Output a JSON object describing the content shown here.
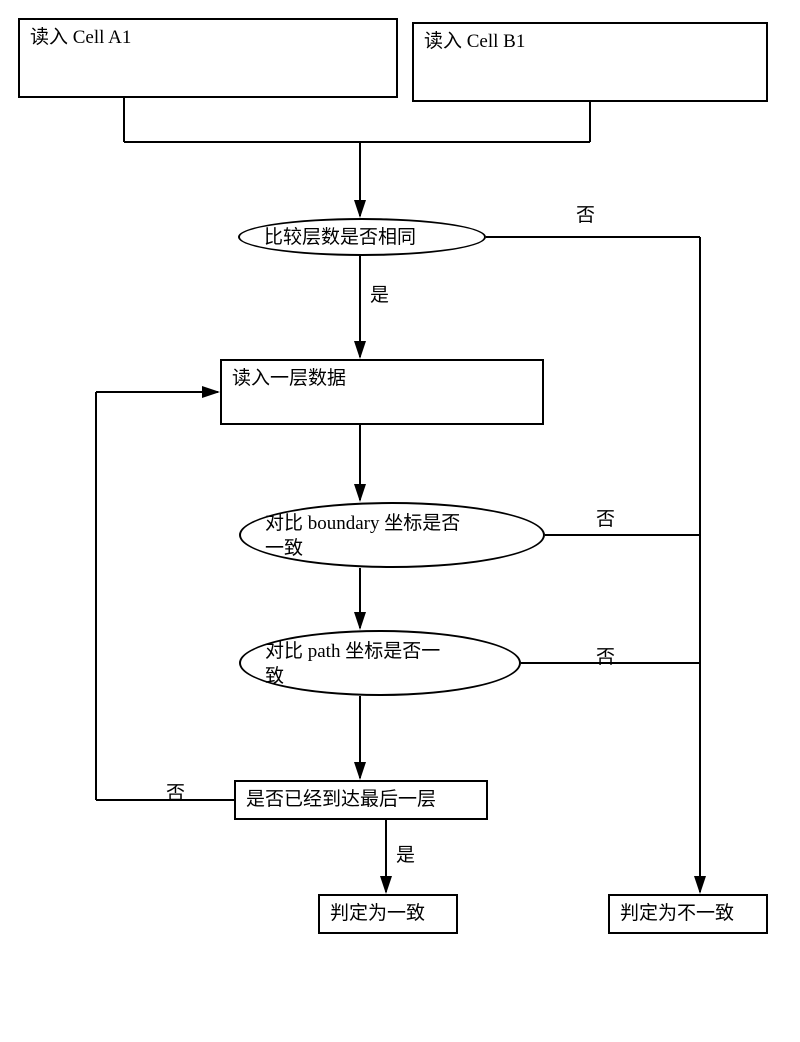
{
  "nodes": {
    "inputA": "读入 Cell A1",
    "inputB": "读入 Cell B1",
    "cmpLayers": "比较层数是否相同",
    "readLayer": "读入一层数据",
    "cmpBoundary": "对比 boundary 坐标是否\n一致",
    "cmpPath": "对比 path 坐标是否一\n致",
    "lastLayer": "是否已经到达最后一层",
    "resultYes": "判定为一致",
    "resultNo": "判定为不一致"
  },
  "labels": {
    "yes": "是",
    "no": "否"
  },
  "chart_data": {
    "type": "flowchart",
    "nodes": [
      {
        "id": "A1",
        "kind": "process",
        "text": "读入 Cell A1"
      },
      {
        "id": "B1",
        "kind": "process",
        "text": "读入 Cell B1"
      },
      {
        "id": "D1",
        "kind": "decision",
        "text": "比较层数是否相同"
      },
      {
        "id": "P2",
        "kind": "process",
        "text": "读入一层数据"
      },
      {
        "id": "D2",
        "kind": "decision",
        "text": "对比 boundary 坐标是否一致"
      },
      {
        "id": "D3",
        "kind": "decision",
        "text": "对比 path 坐标是否一致"
      },
      {
        "id": "D4",
        "kind": "decision",
        "text": "是否已经到达最后一层"
      },
      {
        "id": "Y",
        "kind": "terminal",
        "text": "判定为一致"
      },
      {
        "id": "N",
        "kind": "terminal",
        "text": "判定为不一致"
      }
    ],
    "edges": [
      {
        "from": "A1",
        "to": "D1"
      },
      {
        "from": "B1",
        "to": "D1"
      },
      {
        "from": "D1",
        "to": "P2",
        "label": "是"
      },
      {
        "from": "D1",
        "to": "N",
        "label": "否"
      },
      {
        "from": "P2",
        "to": "D2"
      },
      {
        "from": "D2",
        "to": "D3"
      },
      {
        "from": "D2",
        "to": "N",
        "label": "否"
      },
      {
        "from": "D3",
        "to": "D4"
      },
      {
        "from": "D3",
        "to": "N",
        "label": "否"
      },
      {
        "from": "D4",
        "to": "Y",
        "label": "是"
      },
      {
        "from": "D4",
        "to": "P2",
        "label": "否"
      }
    ]
  }
}
